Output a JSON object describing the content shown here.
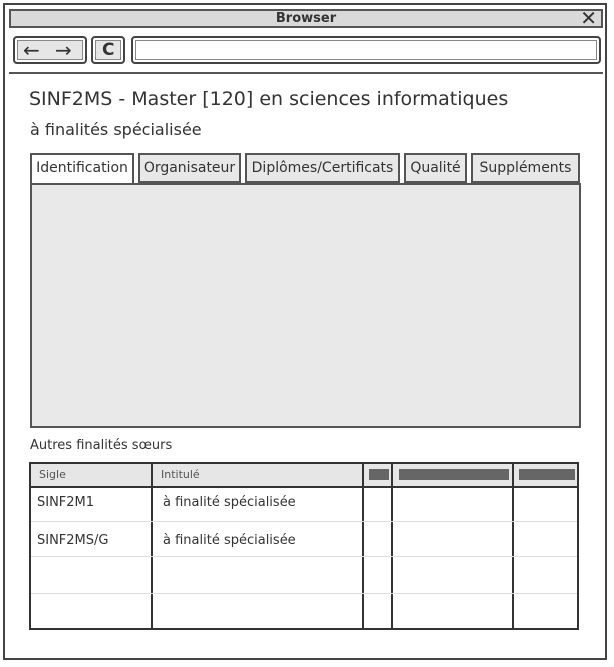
{
  "window": {
    "title": "Browser"
  },
  "toolbar": {
    "back_glyph": "←",
    "forward_glyph": "→",
    "reload_glyph": "C",
    "url": ""
  },
  "page": {
    "title": "SINF2MS - Master [120] en sciences informatiques",
    "subtitle": "à finalités spécialisée"
  },
  "tabs": [
    {
      "label": "Identification",
      "active": true
    },
    {
      "label": "Organisateur",
      "active": false
    },
    {
      "label": "Diplômes/Certificats",
      "active": false
    },
    {
      "label": "Qualité",
      "active": false
    },
    {
      "label": "Suppléments",
      "active": false
    }
  ],
  "siblings": {
    "label": "Autres finalités sœurs",
    "columns": [
      "Sigle",
      "Intitulé"
    ],
    "rows": [
      {
        "sigle": "SINF2M1",
        "intitule": "à finalité spécialisée"
      },
      {
        "sigle": "SINF2MS/G",
        "intitule": "à finalité spécialisée"
      }
    ]
  },
  "icons": {
    "close": "close-icon",
    "back": "arrow-left-icon",
    "forward": "arrow-right-icon",
    "reload": "reload-icon"
  }
}
